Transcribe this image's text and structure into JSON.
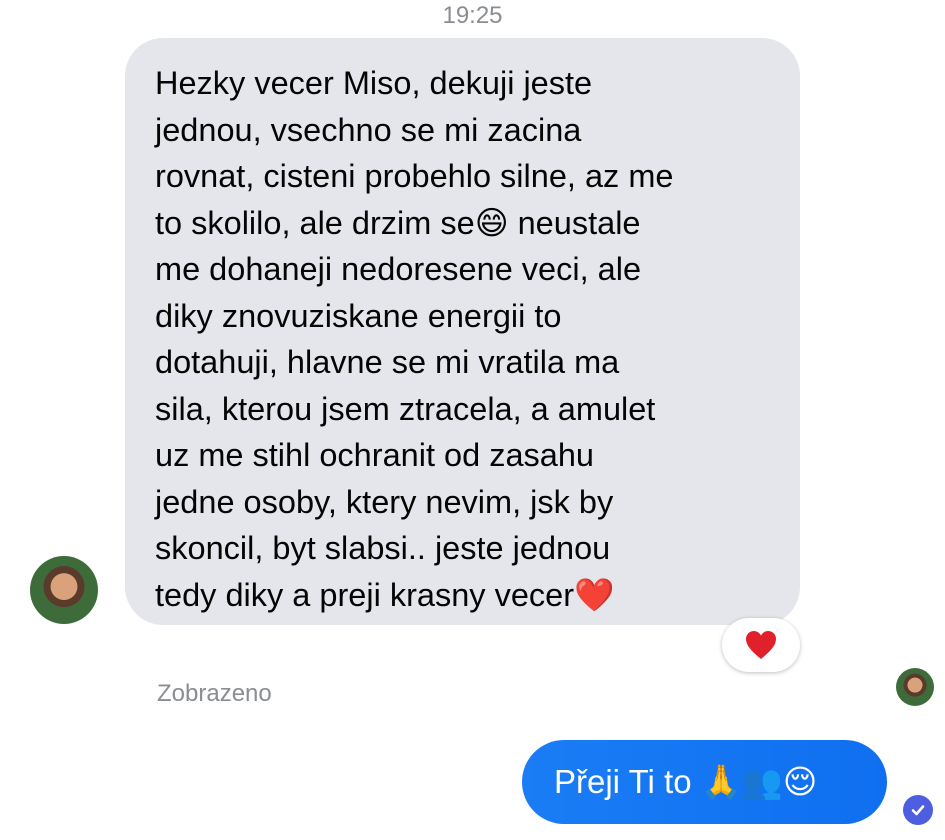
{
  "timestamp": "19:25",
  "incoming_message": {
    "text": "Hezky vecer Miso, dekuji jeste\njednou, vsechno se mi zacina\nrovnat, cisteni probehlo silne, az me\nto skolilo, ale drzim se😄 neustale\nme dohaneji nedoresene veci, ale\ndiky znovuziskane energii to\ndotahuji, hlavne se mi vratila ma\nsila, kterou jsem ztracela, a amulet\nuz me stihl ochranit od zasahu\njedne osoby, ktery nevim, jsk by\nskoncil, byt slabsi.. jeste jednou\ntedy diky a preji krasny vecer❤️",
    "reaction_icon": "heart-icon",
    "bubble_color": "#e4e6eb"
  },
  "seen_label": "Zobrazeno",
  "outgoing_message": {
    "text": "Přeji Ti to 🙏👥😌",
    "bubble_color": "#0f74f2"
  },
  "colors": {
    "heart": "#e0202a",
    "delivered_badge": "#4d5ee0",
    "muted_text": "#8a8d91"
  }
}
